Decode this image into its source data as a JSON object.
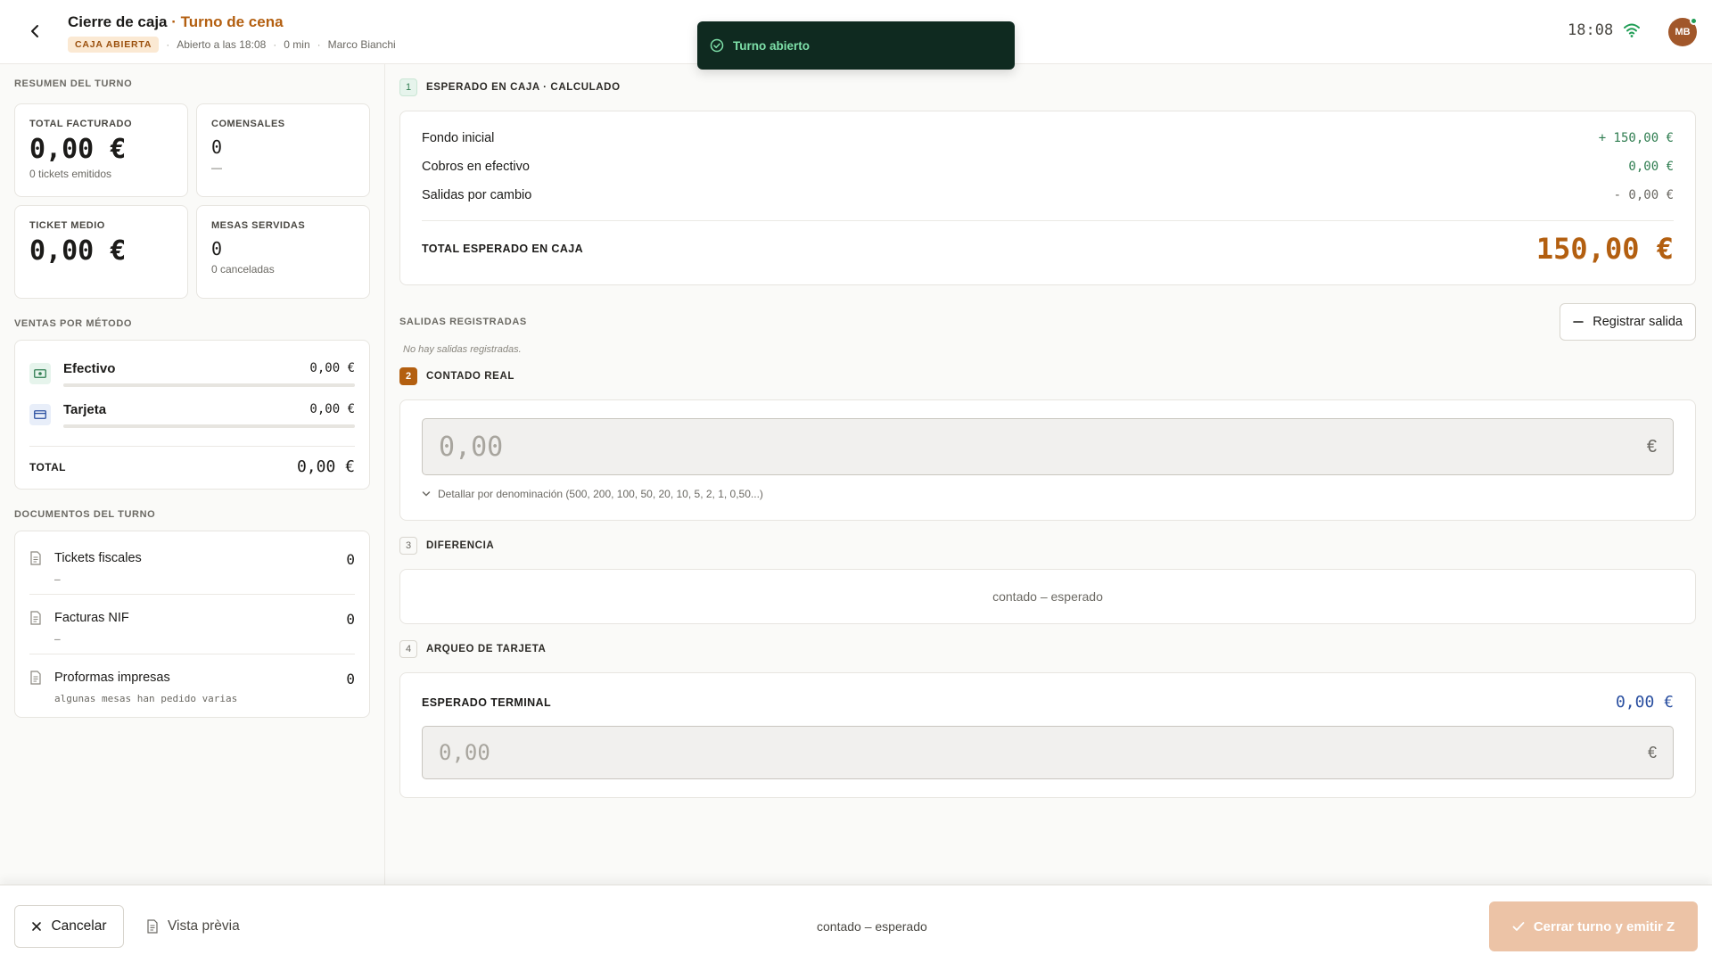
{
  "header": {
    "title": "Cierre de caja",
    "title_sep": " · ",
    "shift_name": "Turno de cena",
    "status_badge": "CAJA ABIERTA",
    "opened_at": "Abierto a las 18:08",
    "duration": "0 min",
    "user": "Marco Bianchi",
    "clock": "18:08",
    "avatar_initials": "MB",
    "separator": "·"
  },
  "toast": {
    "text": "Turno abierto"
  },
  "summary": {
    "section_label": "RESUMEN DEL TURNO",
    "total_facturado": {
      "label": "TOTAL FACTURADO",
      "value": "0,00 €",
      "sub": "0 tickets emitidos"
    },
    "comensales": {
      "label": "COMENSALES",
      "value": "0",
      "sub": "—"
    },
    "ticket_medio": {
      "label": "TICKET MEDIO",
      "value": "0,00 €"
    },
    "mesas_servidas": {
      "label": "MESAS SERVIDAS",
      "value": "0",
      "sub": "0 canceladas"
    }
  },
  "ventas": {
    "section_label": "VENTAS POR MÉTODO",
    "methods": [
      {
        "name": "Efectivo",
        "value": "0,00 €",
        "icon": "cash-icon",
        "share": 0
      },
      {
        "name": "Tarjeta",
        "value": "0,00 €",
        "icon": "card-icon",
        "share": 0
      }
    ],
    "total_label": "TOTAL",
    "total_value": "0,00 €"
  },
  "documentos": {
    "section_label": "DOCUMENTOS DEL TURNO",
    "items": [
      {
        "name": "Tickets fiscales",
        "count": "0",
        "sub": "—"
      },
      {
        "name": "Facturas NIF",
        "count": "0",
        "sub": "—"
      },
      {
        "name": "Proformas impresas",
        "count": "0",
        "sub": "algunas mesas han pedido varias"
      }
    ]
  },
  "steps": {
    "esperado": {
      "num": "1",
      "title": "ESPERADO EN CAJA · CALCULADO",
      "rows": [
        {
          "label": "Fondo inicial",
          "value": "+ 150,00 €"
        },
        {
          "label": "Cobros en efectivo",
          "value": "0,00 €"
        },
        {
          "label": "Salidas por cambio",
          "value": "- 0,00 €"
        }
      ],
      "total_label": "TOTAL ESPERADO EN CAJA",
      "total_value": "150,00 €"
    },
    "salidas": {
      "label": "SALIDAS REGISTRADAS",
      "button": "Registrar salida",
      "empty": "No hay salidas registradas."
    },
    "contado": {
      "num": "2",
      "title": "CONTADO REAL",
      "placeholder": "0,00",
      "currency": "€",
      "denom_link": "Detallar por denominación (500, 200, 100, 50, 20, 10, 5, 2, 1, 0,50...)"
    },
    "diferencia": {
      "num": "3",
      "title": "DIFERENCIA",
      "text": "contado – esperado"
    },
    "tarjeta": {
      "num": "4",
      "title": "ARQUEO DE TARJETA",
      "expected_label": "ESPERADO TERMINAL",
      "expected_value": "0,00 €",
      "placeholder": "0,00",
      "currency": "€"
    }
  },
  "footer": {
    "cancel": "Cancelar",
    "preview": "Vista prèvia",
    "center_text": "contado – esperado",
    "close": "Cerrar turno y emitir Z"
  },
  "colors": {
    "accent": "#b35f10",
    "success": "#2f7d50",
    "toast_bg": "#0f2a20",
    "card_value": "#2a4fa0"
  }
}
